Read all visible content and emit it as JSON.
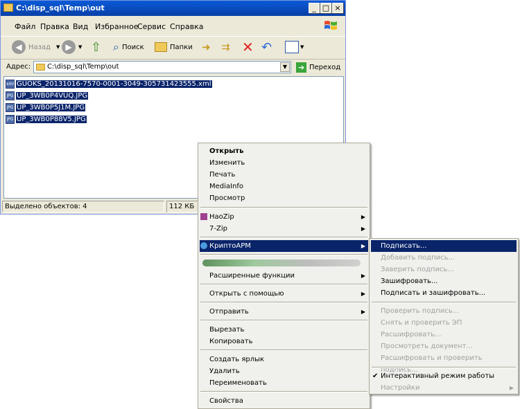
{
  "window": {
    "title": "C:\\disp_sql\\Temp\\out",
    "controls": {
      "minimize": "_",
      "maximize": "□",
      "close": "×"
    }
  },
  "menubar": [
    "Файл",
    "Правка",
    "Вид",
    "Избранное",
    "Сервис",
    "Справка"
  ],
  "toolbar": {
    "back": "Назад",
    "search": "Поиск",
    "folders": "Папки"
  },
  "address": {
    "label": "Адрес:",
    "value": "C:\\disp_sql\\Temp\\out",
    "go": "Переход"
  },
  "files": [
    {
      "name": "GUOKS_20131016-7570-0001-3049-305731423555.xml",
      "icon": "xml-file-icon"
    },
    {
      "name": "UP_3WB0P4VUQ.JPG",
      "icon": "jpg-file-icon"
    },
    {
      "name": "UP_3WB0P5J1M.JPG",
      "icon": "jpg-file-icon"
    },
    {
      "name": "UP_3WB0P88V5.JPG",
      "icon": "jpg-file-icon"
    }
  ],
  "status": {
    "selected": "Выделено объектов: 4",
    "size": "112 КБ"
  },
  "context_menu": {
    "items": {
      "open": "Открыть",
      "edit": "Изменить",
      "print": "Печать",
      "mediainfo": "MediaInfo",
      "preview": "Просмотр",
      "haozip": "HaoZip",
      "sevenzip": "7-Zip",
      "cryptoarm": "КриптоАРМ",
      "extended": "Расширенные функции",
      "open_with": "Открыть с помощью",
      "send_to": "Отправить",
      "cut": "Вырезать",
      "copy": "Копировать",
      "shortcut": "Создать ярлык",
      "delete": "Удалить",
      "rename": "Переименовать",
      "properties": "Свойства"
    }
  },
  "submenu": {
    "items": {
      "sign": "Подписать...",
      "add_signature": "Добавить подпись...",
      "cosign": "Заверить подпись...",
      "encrypt": "Зашифровать...",
      "sign_encrypt": "Подписать и зашифровать...",
      "verify": "Проверить подпись...",
      "remove_verify": "Снять и проверить ЭП",
      "decrypt": "Расшифровать...",
      "view_doc": "Просмотреть документ...",
      "decrypt_verify": "Расшифровать и проверить подпись...",
      "interactive": "Интерактивный режим работы",
      "settings": "Настройки"
    },
    "interactive_checked": true
  },
  "colors": {
    "selection": "#0a246a",
    "titlebar": "#0a5ad6",
    "disabled_text": "#a0a0a0"
  }
}
